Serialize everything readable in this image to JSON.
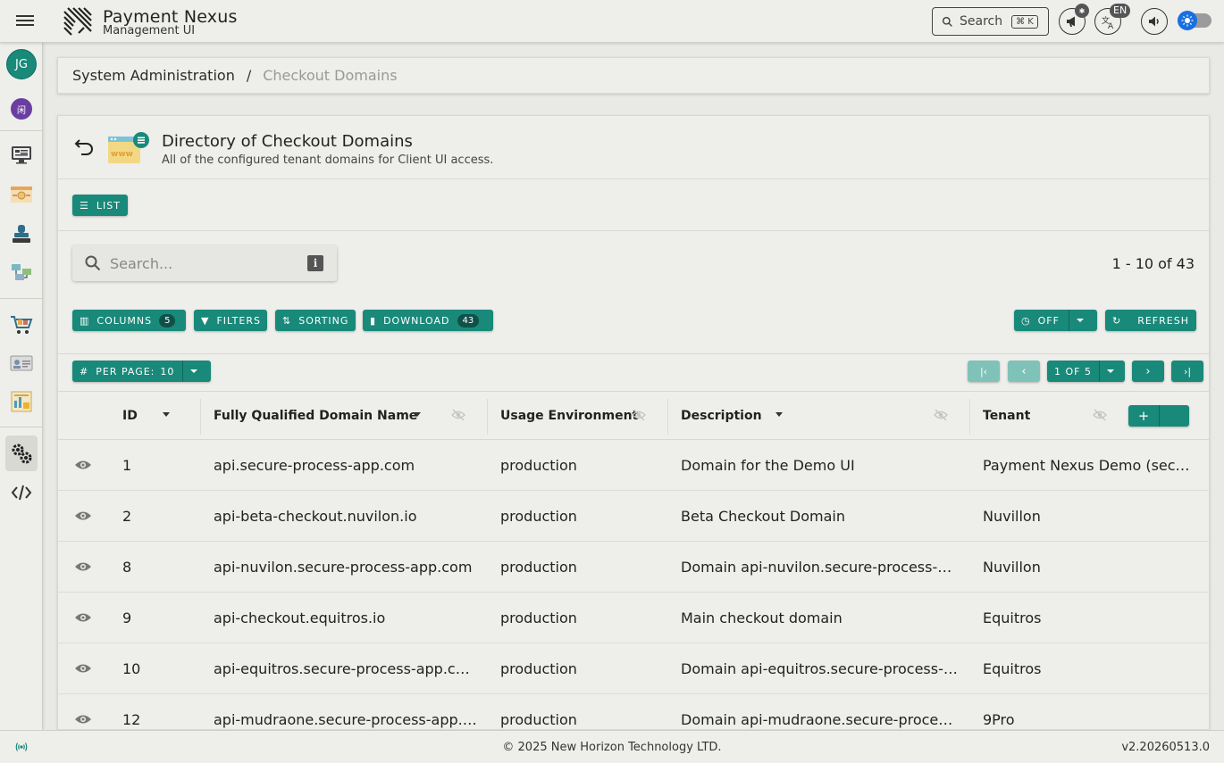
{
  "app": {
    "title": "Payment Nexus",
    "subtitle": "Management UI",
    "search_label": "Search",
    "search_shortcut": "⌘ K",
    "language": "EN",
    "accent_color": "#19897a"
  },
  "user": {
    "initials": "JG",
    "tenant_initial": "闲"
  },
  "breadcrumb": {
    "parent": "System Administration",
    "separator": "/",
    "current": "Checkout Domains"
  },
  "page": {
    "title": "Directory of Checkout Domains",
    "description": "All of the configured tenant domains for Client UI access.",
    "view_label": "LIST"
  },
  "search": {
    "placeholder": "Search..."
  },
  "results": {
    "range": "1 - 10 of 43"
  },
  "toolbar": {
    "columns_label": "COLUMNS",
    "columns_count": "5",
    "filters_label": "FILTERS",
    "sorting_label": "SORTING",
    "download_label": "DOWNLOAD",
    "download_count": "43",
    "auto_refresh_label": "OFF",
    "refresh_label": "REFRESH"
  },
  "pagination": {
    "per_page_label": "PER PAGE:",
    "per_page_value": "10",
    "page_label": "1 OF 5"
  },
  "table": {
    "columns": [
      "ID",
      "Fully Qualified Domain Name",
      "Usage Environment",
      "Description",
      "Tenant"
    ],
    "rows": [
      {
        "id": "1",
        "fqdn": "api.secure-process-app.com",
        "env": "production",
        "desc": "Domain for the Demo UI",
        "tenant": "Payment Nexus Demo (secure-process-app)"
      },
      {
        "id": "2",
        "fqdn": "api-beta-checkout.nuvilon.io",
        "env": "production",
        "desc": "Beta Checkout Domain",
        "tenant": "Nuvillon"
      },
      {
        "id": "8",
        "fqdn": "api-nuvilon.secure-process-app.com",
        "env": "production",
        "desc": "Domain api-nuvilon.secure-process-app.com",
        "tenant": "Nuvillon"
      },
      {
        "id": "9",
        "fqdn": "api-checkout.equitros.io",
        "env": "production",
        "desc": "Main checkout domain",
        "tenant": "Equitros"
      },
      {
        "id": "10",
        "fqdn": "api-equitros.secure-process-app.com",
        "env": "production",
        "desc": "Domain api-equitros.secure-process-app.com",
        "tenant": "Equitros"
      },
      {
        "id": "12",
        "fqdn": "api-mudraone.secure-process-app.com",
        "env": "production",
        "desc": "Domain api-mudraone.secure-process-app.com",
        "tenant": "9Pro"
      }
    ]
  },
  "footer": {
    "copyright": "© 2025 New Horizon Technology LTD.",
    "version": "v2.20260513.0"
  }
}
